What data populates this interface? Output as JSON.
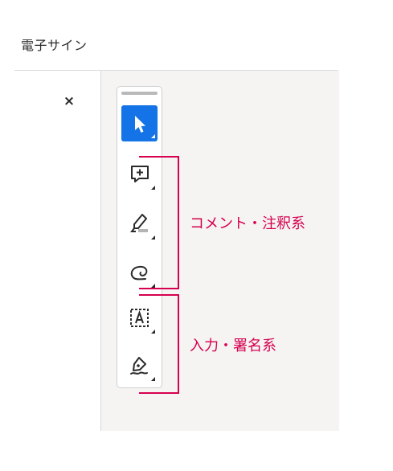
{
  "header": {
    "title": "電子サイン"
  },
  "panel": {
    "close_label": "×"
  },
  "toolbar": {
    "tools": [
      {
        "id": "select",
        "icon": "select-arrow-icon",
        "selected": true
      },
      {
        "id": "add-comment",
        "icon": "comment-plus-icon",
        "selected": false
      },
      {
        "id": "highlight",
        "icon": "highlighter-pen-icon",
        "selected": false
      },
      {
        "id": "freeform",
        "icon": "lasso-draw-icon",
        "selected": false
      },
      {
        "id": "text-field",
        "icon": "text-box-icon",
        "selected": false
      },
      {
        "id": "sign",
        "icon": "signature-pen-icon",
        "selected": false
      }
    ]
  },
  "annotations": {
    "comment_group": "コメント・注釈系",
    "input_group": "入力・署名系"
  },
  "colors": {
    "accent": "#1473e6",
    "annotation": "#d6004f",
    "panel_bg": "#f5f4f3"
  }
}
